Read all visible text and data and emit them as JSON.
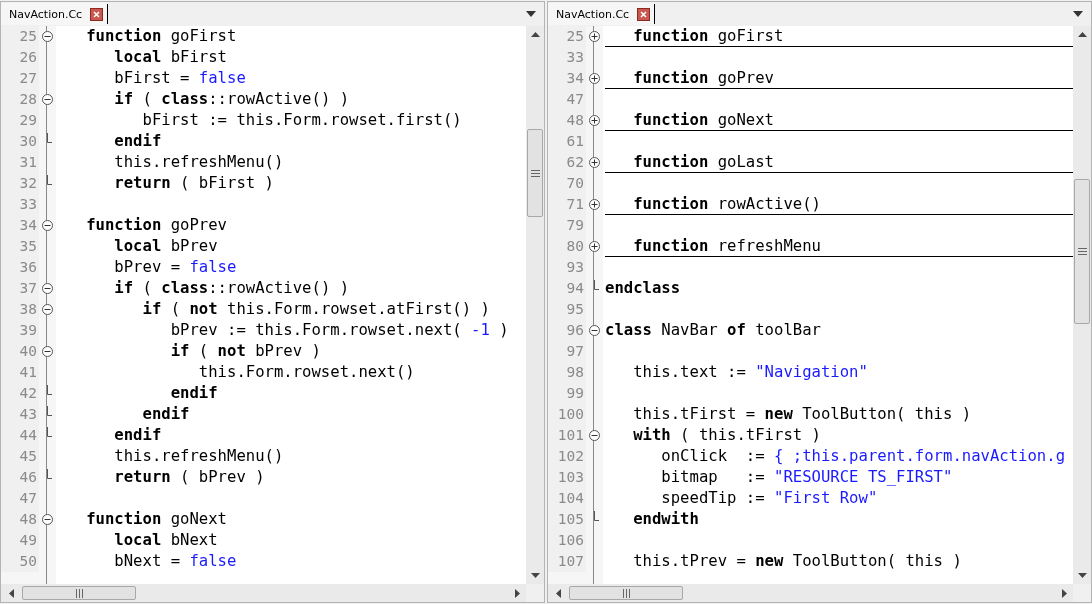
{
  "panes": [
    {
      "tab": {
        "label": "NavAction.Cc",
        "selected": true
      },
      "lines": [
        {
          "number": "25",
          "kind": "start",
          "code": [
            {
              "text": "   function",
              "kind": "keyword"
            },
            {
              "text": " goFirst",
              "kind": "plain"
            }
          ]
        },
        {
          "number": "26",
          "kind": "plain",
          "code": [
            {
              "text": "      local",
              "kind": "keyword"
            },
            {
              "text": " bFirst",
              "kind": "plain"
            }
          ]
        },
        {
          "number": "27",
          "kind": "plain",
          "code": [
            {
              "text": "      bFirst = ",
              "kind": "plain"
            },
            {
              "text": "false",
              "kind": "literal"
            }
          ]
        },
        {
          "number": "28",
          "kind": "start",
          "code": [
            {
              "text": "      if",
              "kind": "keyword"
            },
            {
              "text": " ( ",
              "kind": "plain"
            },
            {
              "text": "class",
              "kind": "keyword"
            },
            {
              "text": "::rowActive() )",
              "kind": "plain"
            }
          ]
        },
        {
          "number": "29",
          "kind": "plain",
          "code": [
            {
              "text": "         bFirst := this.Form.rowset.first()",
              "kind": "plain"
            }
          ]
        },
        {
          "number": "30",
          "kind": "end",
          "code": [
            {
              "text": "      endif",
              "kind": "keyword"
            }
          ]
        },
        {
          "number": "31",
          "kind": "plain",
          "code": [
            {
              "text": "      this.refreshMenu()",
              "kind": "plain"
            }
          ]
        },
        {
          "number": "32",
          "kind": "end",
          "code": [
            {
              "text": "      return",
              "kind": "keyword"
            },
            {
              "text": " ( bFirst )",
              "kind": "plain"
            }
          ]
        },
        {
          "number": "33",
          "kind": "plain"
        },
        {
          "number": "34",
          "kind": "start",
          "code": [
            {
              "text": "   function",
              "kind": "keyword"
            },
            {
              "text": " goPrev",
              "kind": "plain"
            }
          ]
        },
        {
          "number": "35",
          "kind": "plain",
          "code": [
            {
              "text": "      local",
              "kind": "keyword"
            },
            {
              "text": " bPrev",
              "kind": "plain"
            }
          ]
        },
        {
          "number": "36",
          "kind": "plain",
          "code": [
            {
              "text": "      bPrev = ",
              "kind": "plain"
            },
            {
              "text": "false",
              "kind": "literal"
            }
          ]
        },
        {
          "number": "37",
          "kind": "start",
          "code": [
            {
              "text": "      if",
              "kind": "keyword"
            },
            {
              "text": " ( ",
              "kind": "plain"
            },
            {
              "text": "class",
              "kind": "keyword"
            },
            {
              "text": "::rowActive() )",
              "kind": "plain"
            }
          ]
        },
        {
          "number": "38",
          "kind": "start",
          "code": [
            {
              "text": "         if",
              "kind": "keyword"
            },
            {
              "text": " ( ",
              "kind": "plain"
            },
            {
              "text": "not",
              "kind": "keyword"
            },
            {
              "text": " this.Form.rowset.atFirst() )",
              "kind": "plain"
            }
          ]
        },
        {
          "number": "39",
          "kind": "plain",
          "code": [
            {
              "text": "            bPrev := this.Form.rowset.next( ",
              "kind": "plain"
            },
            {
              "text": "-1",
              "kind": "literal"
            },
            {
              "text": " )",
              "kind": "plain"
            }
          ]
        },
        {
          "number": "40",
          "kind": "start",
          "code": [
            {
              "text": "            if",
              "kind": "keyword"
            },
            {
              "text": " ( ",
              "kind": "plain"
            },
            {
              "text": "not",
              "kind": "keyword"
            },
            {
              "text": " bPrev )",
              "kind": "plain"
            }
          ]
        },
        {
          "number": "41",
          "kind": "plain",
          "code": [
            {
              "text": "               this.Form.rowset.next()",
              "kind": "plain"
            }
          ]
        },
        {
          "number": "42",
          "kind": "end",
          "code": [
            {
              "text": "            endif",
              "kind": "keyword"
            }
          ]
        },
        {
          "number": "43",
          "kind": "end",
          "code": [
            {
              "text": "         endif",
              "kind": "keyword"
            }
          ]
        },
        {
          "number": "44",
          "kind": "end",
          "code": [
            {
              "text": "      endif",
              "kind": "keyword"
            }
          ]
        },
        {
          "number": "45",
          "kind": "plain",
          "code": [
            {
              "text": "      this.refreshMenu()",
              "kind": "plain"
            }
          ]
        },
        {
          "number": "46",
          "kind": "end",
          "code": [
            {
              "text": "      return",
              "kind": "keyword"
            },
            {
              "text": " ( bPrev )",
              "kind": "plain"
            }
          ]
        },
        {
          "number": "47",
          "kind": "plain"
        },
        {
          "number": "48",
          "kind": "start",
          "code": [
            {
              "text": "   function",
              "kind": "keyword"
            },
            {
              "text": " goNext",
              "kind": "plain"
            }
          ]
        },
        {
          "number": "49",
          "kind": "plain",
          "code": [
            {
              "text": "      local",
              "kind": "keyword"
            },
            {
              "text": " bNext",
              "kind": "plain"
            }
          ]
        },
        {
          "number": "50",
          "kind": "plain",
          "code": [
            {
              "text": "      bNext = ",
              "kind": "plain"
            },
            {
              "text": "false",
              "kind": "literal"
            }
          ]
        }
      ]
    },
    {
      "tab": {
        "label": "NavAction.Cc",
        "selected": true
      },
      "lines": [
        {
          "number": "25",
          "kind": "collapsed",
          "code": [
            {
              "text": "   function",
              "kind": "keyword"
            },
            {
              "text": " goFirst",
              "kind": "plain"
            }
          ]
        },
        {
          "number": "33",
          "kind": "plain"
        },
        {
          "number": "34",
          "kind": "collapsed",
          "code": [
            {
              "text": "   function",
              "kind": "keyword"
            },
            {
              "text": " goPrev",
              "kind": "plain"
            }
          ]
        },
        {
          "number": "47",
          "kind": "plain"
        },
        {
          "number": "48",
          "kind": "collapsed",
          "code": [
            {
              "text": "   function",
              "kind": "keyword"
            },
            {
              "text": " goNext",
              "kind": "plain"
            }
          ]
        },
        {
          "number": "61",
          "kind": "plain"
        },
        {
          "number": "62",
          "kind": "collapsed",
          "code": [
            {
              "text": "   function",
              "kind": "keyword"
            },
            {
              "text": " goLast",
              "kind": "plain"
            }
          ]
        },
        {
          "number": "70",
          "kind": "plain"
        },
        {
          "number": "71",
          "kind": "collapsed",
          "code": [
            {
              "text": "   function",
              "kind": "keyword"
            },
            {
              "text": " rowActive()",
              "kind": "plain"
            }
          ]
        },
        {
          "number": "79",
          "kind": "plain"
        },
        {
          "number": "80",
          "kind": "collapsed",
          "code": [
            {
              "text": "   function",
              "kind": "keyword"
            },
            {
              "text": " refreshMenu",
              "kind": "plain"
            }
          ]
        },
        {
          "number": "93",
          "kind": "plain"
        },
        {
          "number": "94",
          "kind": "end",
          "code": [
            {
              "text": "endclass",
              "kind": "keyword"
            }
          ]
        },
        {
          "number": "95",
          "kind": "plain"
        },
        {
          "number": "96",
          "kind": "start",
          "code": [
            {
              "text": "class",
              "kind": "keyword"
            },
            {
              "text": " NavBar ",
              "kind": "plain"
            },
            {
              "text": "of",
              "kind": "keyword"
            },
            {
              "text": " toolBar",
              "kind": "plain"
            }
          ]
        },
        {
          "number": "97",
          "kind": "plain"
        },
        {
          "number": "98",
          "kind": "plain",
          "code": [
            {
              "text": "   this.text := ",
              "kind": "plain"
            },
            {
              "text": "\"Navigation\"",
              "kind": "literal"
            }
          ]
        },
        {
          "number": "99",
          "kind": "plain"
        },
        {
          "number": "100",
          "kind": "plain",
          "code": [
            {
              "text": "   this.tFirst = ",
              "kind": "plain"
            },
            {
              "text": "new",
              "kind": "keyword"
            },
            {
              "text": " ToolButton( this )",
              "kind": "plain"
            }
          ]
        },
        {
          "number": "101",
          "kind": "start",
          "code": [
            {
              "text": "   with",
              "kind": "keyword"
            },
            {
              "text": " ( this.tFirst )",
              "kind": "plain"
            }
          ]
        },
        {
          "number": "102",
          "kind": "plain",
          "code": [
            {
              "text": "      onClick  := ",
              "kind": "plain"
            },
            {
              "text": "{ ;this.parent.form.navAction.g",
              "kind": "literal"
            }
          ]
        },
        {
          "number": "103",
          "kind": "plain",
          "code": [
            {
              "text": "      bitmap   := ",
              "kind": "plain"
            },
            {
              "text": "\"RESOURCE TS_FIRST\"",
              "kind": "literal"
            }
          ]
        },
        {
          "number": "104",
          "kind": "plain",
          "code": [
            {
              "text": "      speedTip := ",
              "kind": "plain"
            },
            {
              "text": "\"First Row\"",
              "kind": "literal"
            }
          ]
        },
        {
          "number": "105",
          "kind": "end",
          "code": [
            {
              "text": "   endwith",
              "kind": "keyword"
            }
          ]
        },
        {
          "number": "106",
          "kind": "plain"
        },
        {
          "number": "107",
          "kind": "plain",
          "code": [
            {
              "text": "   this.tPrev = ",
              "kind": "plain"
            },
            {
              "text": "new",
              "kind": "keyword"
            },
            {
              "text": " ToolButton( this )",
              "kind": "plain"
            }
          ]
        }
      ]
    }
  ]
}
